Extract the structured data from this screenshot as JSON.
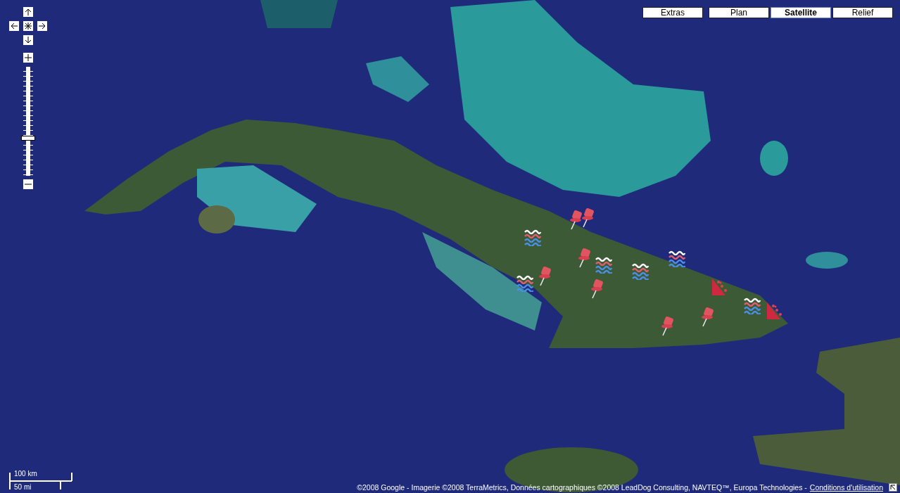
{
  "map_type_buttons": [
    {
      "label": "Extras",
      "selected": false
    },
    {
      "label": "Plan",
      "selected": false
    },
    {
      "label": "Satellite",
      "selected": true
    },
    {
      "label": "Relief",
      "selected": false
    }
  ],
  "zoom_slider": {
    "level": 0.34
  },
  "markers": [
    {
      "kind": "waves"
    },
    {
      "kind": "pin"
    },
    {
      "kind": "pin"
    },
    {
      "kind": "waves"
    },
    {
      "kind": "pin"
    },
    {
      "kind": "pin"
    },
    {
      "kind": "waves"
    },
    {
      "kind": "pin"
    },
    {
      "kind": "waves"
    },
    {
      "kind": "waves"
    },
    {
      "kind": "landslide"
    },
    {
      "kind": "waves"
    },
    {
      "kind": "landslide"
    },
    {
      "kind": "pin"
    },
    {
      "kind": "pin"
    }
  ],
  "scale": {
    "metric": "100 km",
    "imperial": "50 mi"
  },
  "attribution": {
    "text": "©2008 Google - Imagerie ©2008 TerraMetrics, Données cartographiques ©2008 LeadDog Consulting, NAVTEQ™, Europa Technologies -",
    "link": "Conditions d'utilisation"
  }
}
